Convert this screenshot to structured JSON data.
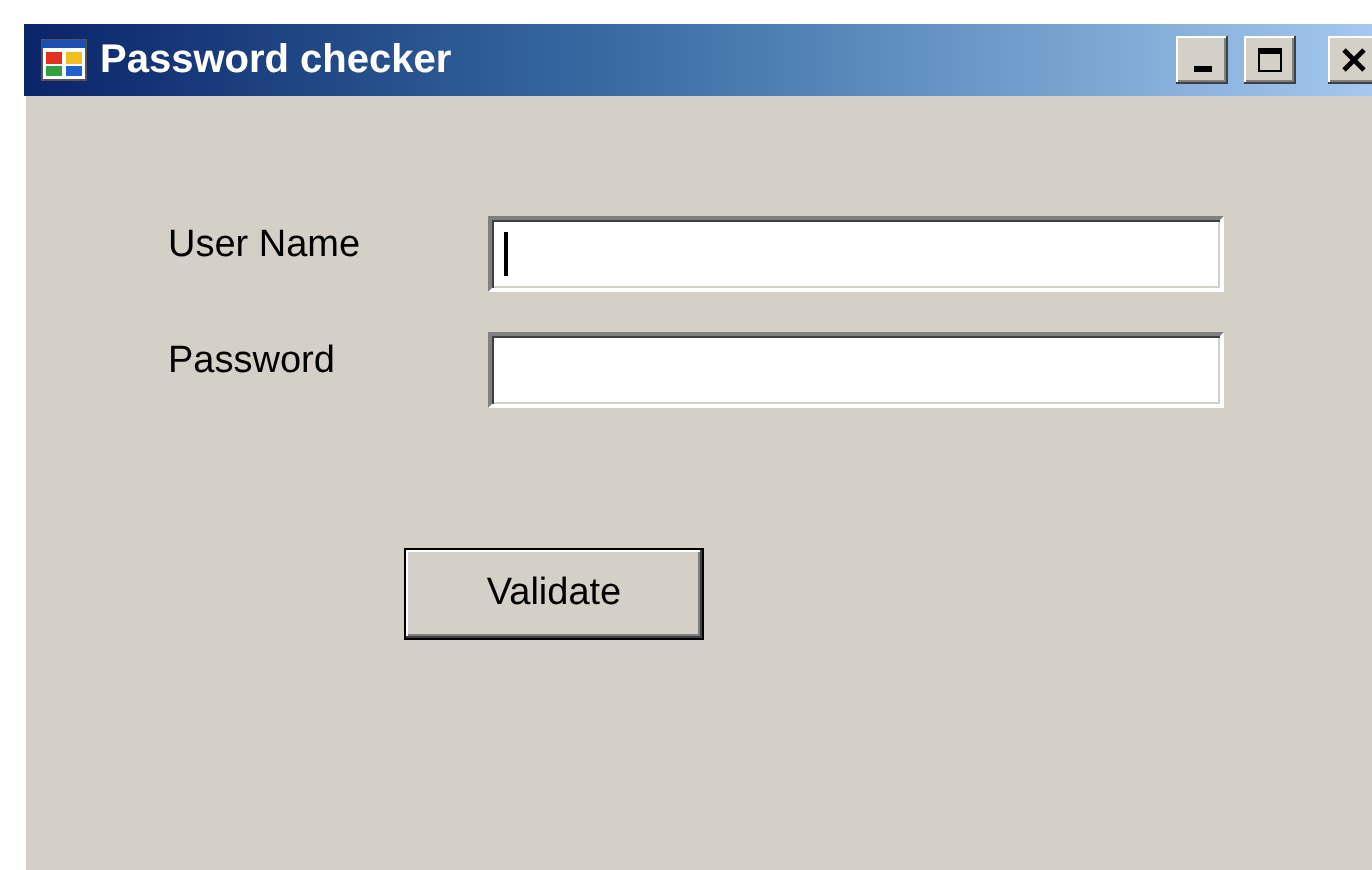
{
  "window": {
    "title": "Password checker"
  },
  "fields": [
    {
      "label": "User Name",
      "focused": true
    },
    {
      "label": "Password",
      "focused": false
    }
  ],
  "buttons": [
    "Validate"
  ]
}
